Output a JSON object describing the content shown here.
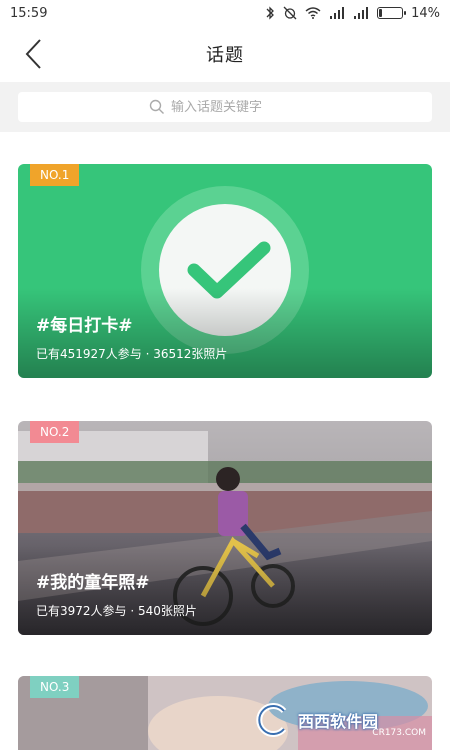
{
  "status_bar": {
    "time": "15:59",
    "battery_percent": "14%",
    "battery_level": 0.14
  },
  "header": {
    "title": "话题",
    "back_icon": "back-chevron-icon"
  },
  "search": {
    "placeholder": "输入话题关键字",
    "icon": "search-icon"
  },
  "topics": [
    {
      "rank": "NO.1",
      "title": "#每日打卡#",
      "stats": "已有451927人参与 · 36512张照片",
      "color": "#36c57a",
      "badge_color": "#f0a42a",
      "icon": "checkmark-icon"
    },
    {
      "rank": "NO.2",
      "title": "#我的童年照#",
      "stats": "已有3972人参与 · 540张照片",
      "badge_color": "#f28a93"
    },
    {
      "rank": "NO.3",
      "badge_color": "#7fd0c1"
    }
  ],
  "watermark": {
    "text": "西西软件园",
    "sub": "CR173.COM"
  }
}
